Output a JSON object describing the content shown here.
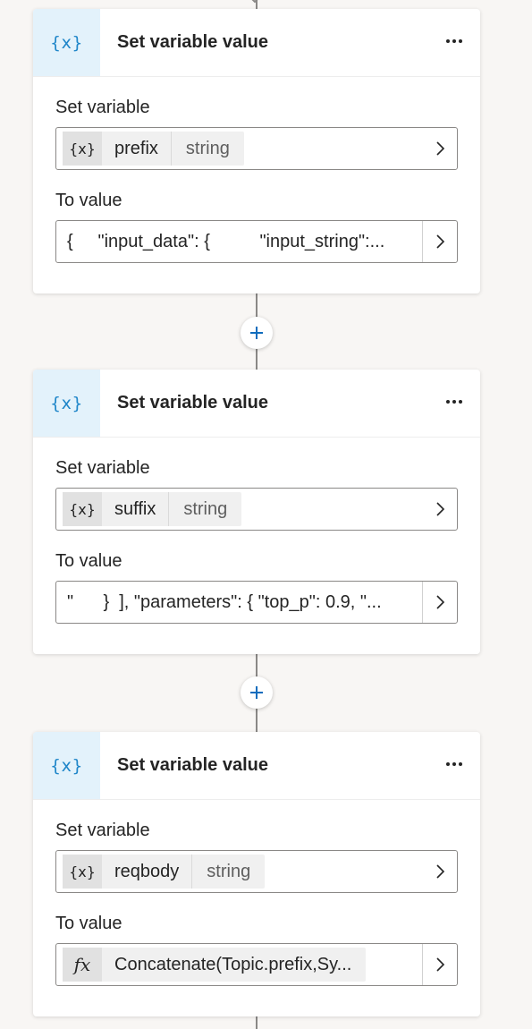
{
  "cards": [
    {
      "header_icon": "{x}",
      "title": "Set variable value",
      "set_variable_label": "Set variable",
      "variable_icon": "{x}",
      "variable_name": "prefix",
      "variable_type": "string",
      "to_value_label": "To value",
      "value_text": "{     \"input_data\": {          \"input_string\":..."
    },
    {
      "header_icon": "{x}",
      "title": "Set variable value",
      "set_variable_label": "Set variable",
      "variable_icon": "{x}",
      "variable_name": "suffix",
      "variable_type": "string",
      "to_value_label": "To value",
      "value_text": "\"      }  ], \"parameters\": { \"top_p\": 0.9, \"..."
    },
    {
      "header_icon": "{x}",
      "title": "Set variable value",
      "set_variable_label": "Set variable",
      "variable_icon": "{x}",
      "variable_name": "reqbody",
      "variable_type": "string",
      "to_value_label": "To value",
      "value_icon": "fx",
      "value_text": "Concatenate(Topic.prefix,Sy..."
    }
  ],
  "icons": {
    "header": "variable-icon",
    "more": "more-options-icon",
    "chevron": "chevron-right-icon",
    "add": "plus-icon",
    "formula": "function-icon"
  },
  "colors": {
    "accent": "#1f86c9",
    "header_icon_bg": "#e3f2fb",
    "connector": "#8a8886",
    "background": "#f8f6f4"
  }
}
